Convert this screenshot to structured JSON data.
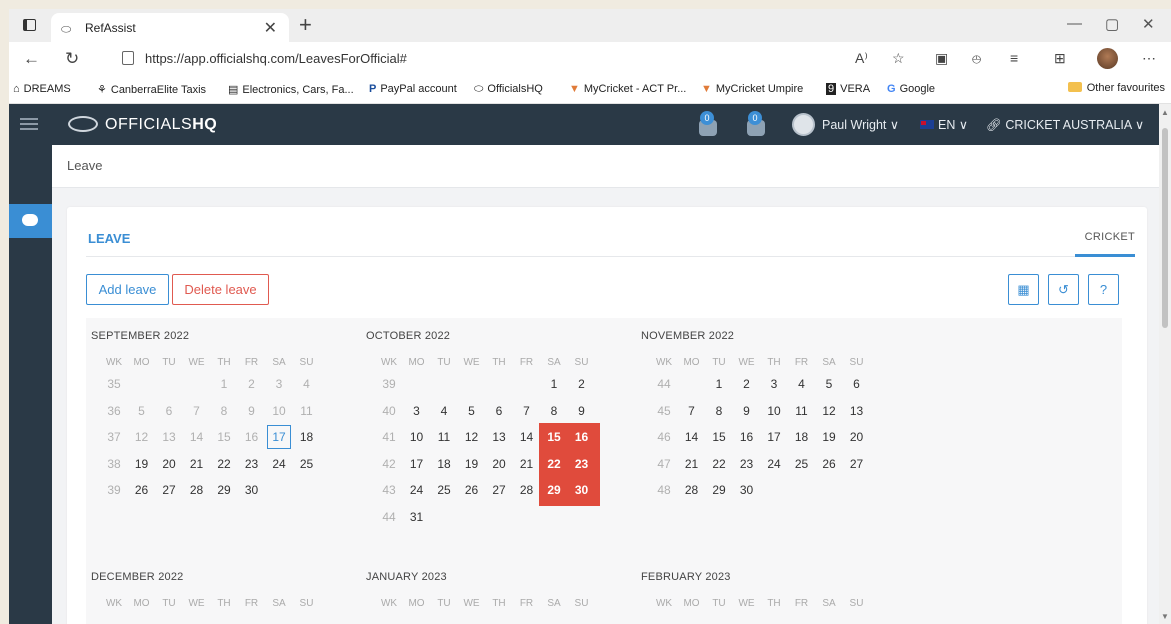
{
  "browser": {
    "tab_title": "RefAssist",
    "url": "https://app.officialshq.com/LeavesForOfficial#",
    "favourites": [
      {
        "label": "DREAMS",
        "icon": "house-icon"
      },
      {
        "label": "CanberraElite Taxis",
        "icon": "taxi-icon"
      },
      {
        "label": "Electronics, Cars, Fa...",
        "icon": "store-icon"
      },
      {
        "label": "PayPal account",
        "icon": "paypal-icon"
      },
      {
        "label": "OfficialsHQ",
        "icon": "whistle-icon"
      },
      {
        "label": "MyCricket - ACT Pr...",
        "icon": "cricket-icon"
      },
      {
        "label": "MyCricket Umpire",
        "icon": "cricket-icon"
      },
      {
        "label": "VERA",
        "icon": "vera-icon"
      },
      {
        "label": "Google",
        "icon": "google-icon"
      }
    ],
    "other_favourites": "Other favourites"
  },
  "app": {
    "brand_prefix": "OFFICIALS",
    "brand_bold": "HQ",
    "notif_count_1": "0",
    "notif_count_2": "0",
    "user_name": "Paul Wright",
    "language": "EN",
    "organisation": "CRICKET AUSTRALIA",
    "accent": "#3a8ed4",
    "leave_color": "#e04b3c",
    "navbar_color": "#2a3946"
  },
  "breadcrumb": "Leave",
  "card": {
    "title": "LEAVE",
    "tab": "CRICKET",
    "add_label": "Add leave",
    "delete_label": "Delete leave",
    "tool_icons": [
      "calendar-icon",
      "history-icon",
      "help-icon"
    ]
  },
  "calendar": {
    "dow": [
      "WK",
      "MO",
      "TU",
      "WE",
      "TH",
      "FR",
      "SA",
      "SU"
    ],
    "months": [
      {
        "title": "SEPTEMBER 2022",
        "weeks": [
          {
            "wk": "35",
            "days": [
              "",
              "",
              "",
              "1",
              "2",
              "3",
              "4"
            ]
          },
          {
            "wk": "36",
            "days": [
              "5",
              "6",
              "7",
              "8",
              "9",
              "10",
              "11"
            ]
          },
          {
            "wk": "37",
            "days": [
              "12",
              "13",
              "14",
              "15",
              "16",
              "17",
              "18"
            ]
          },
          {
            "wk": "38",
            "days": [
              "19",
              "20",
              "21",
              "22",
              "23",
              "24",
              "25"
            ]
          },
          {
            "wk": "39",
            "days": [
              "26",
              "27",
              "28",
              "29",
              "30",
              "",
              ""
            ]
          }
        ],
        "past_until": "16",
        "today": "17",
        "leave": []
      },
      {
        "title": "OCTOBER 2022",
        "weeks": [
          {
            "wk": "39",
            "days": [
              "",
              "",
              "",
              "",
              "",
              "1",
              "2"
            ]
          },
          {
            "wk": "40",
            "days": [
              "3",
              "4",
              "5",
              "6",
              "7",
              "8",
              "9"
            ]
          },
          {
            "wk": "41",
            "days": [
              "10",
              "11",
              "12",
              "13",
              "14",
              "15",
              "16"
            ]
          },
          {
            "wk": "42",
            "days": [
              "17",
              "18",
              "19",
              "20",
              "21",
              "22",
              "23"
            ]
          },
          {
            "wk": "43",
            "days": [
              "24",
              "25",
              "26",
              "27",
              "28",
              "29",
              "30"
            ]
          },
          {
            "wk": "44",
            "days": [
              "31",
              "",
              "",
              "",
              "",
              "",
              ""
            ]
          }
        ],
        "past_until": "",
        "today": "",
        "leave": [
          "15",
          "16",
          "22",
          "23",
          "29",
          "30"
        ]
      },
      {
        "title": "NOVEMBER 2022",
        "weeks": [
          {
            "wk": "44",
            "days": [
              "",
              "1",
              "2",
              "3",
              "4",
              "5",
              "6"
            ]
          },
          {
            "wk": "45",
            "days": [
              "7",
              "8",
              "9",
              "10",
              "11",
              "12",
              "13"
            ]
          },
          {
            "wk": "46",
            "days": [
              "14",
              "15",
              "16",
              "17",
              "18",
              "19",
              "20"
            ]
          },
          {
            "wk": "47",
            "days": [
              "21",
              "22",
              "23",
              "24",
              "25",
              "26",
              "27"
            ]
          },
          {
            "wk": "48",
            "days": [
              "28",
              "29",
              "30",
              "",
              "",
              "",
              ""
            ]
          }
        ],
        "past_until": "",
        "today": "",
        "leave": []
      },
      {
        "title": "DECEMBER 2022",
        "weeks": [],
        "past_until": "",
        "today": "",
        "leave": []
      },
      {
        "title": "JANUARY 2023",
        "weeks": [],
        "past_until": "",
        "today": "",
        "leave": []
      },
      {
        "title": "FEBRUARY 2023",
        "weeks": [],
        "past_until": "",
        "today": "",
        "leave": []
      }
    ]
  }
}
